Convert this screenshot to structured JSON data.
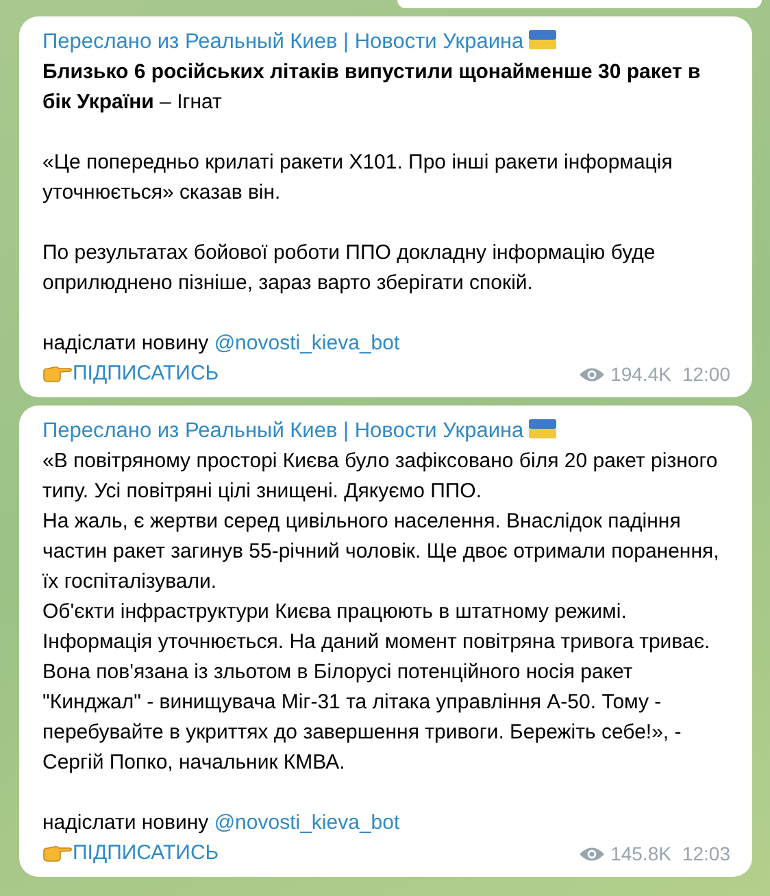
{
  "messages": [
    {
      "forwarded_from": "Переслано из Реальный Киев | Новости Украина",
      "paragraphs": [
        "**Близько 6 російських літаків випустили щонайменше 30 ракет в бік України** – Ігнат",
        "«Це попередньо крилаті ракети Х101. Про інші ракети інформація уточнюється» сказав він.",
        "По результатах бойової роботи ППО докладну інформацію буде оприлюднено пізніше, зараз варто зберігати спокій."
      ],
      "send_news_label": "надіслати новину",
      "bot_link": "@novosti_kieva_bot",
      "subscribe_link": "ПІДПИСАТИСЬ",
      "views": "194.4K",
      "time": "12:00"
    },
    {
      "forwarded_from": "Переслано из Реальный Киев | Новости Украина",
      "paragraphs": [
        "«В повітряному просторі Києва було зафіксовано біля 20 ракет різного типу. Усі повітряні цілі знищені. Дякуємо ППО.\nНа жаль, є жертви серед цивільного населення. Внаслідок падіння частин ракет загинув 55-річний чоловік. Ще двоє отримали поранення, їх госпіталізували.\nОб'єкти інфраструктури Києва працюють в штатному режимі. Інформація уточнюється. На даний момент повітряна тривога триває. Вона пов'язана із зльотом в Білорусі потенційного носія ракет \"Кинджал\" - винищувача Міг-31 та літака управління А-50. Тому - перебувайте в укриттях до завершення тривоги. Бережіть себе!», - Сергій Попко, начальник КМВА."
      ],
      "send_news_label": "надіслати новину",
      "bot_link": "@novosti_kieva_bot",
      "subscribe_link": "ПІДПИСАТИСЬ",
      "views": "145.8K",
      "time": "12:03"
    }
  ]
}
